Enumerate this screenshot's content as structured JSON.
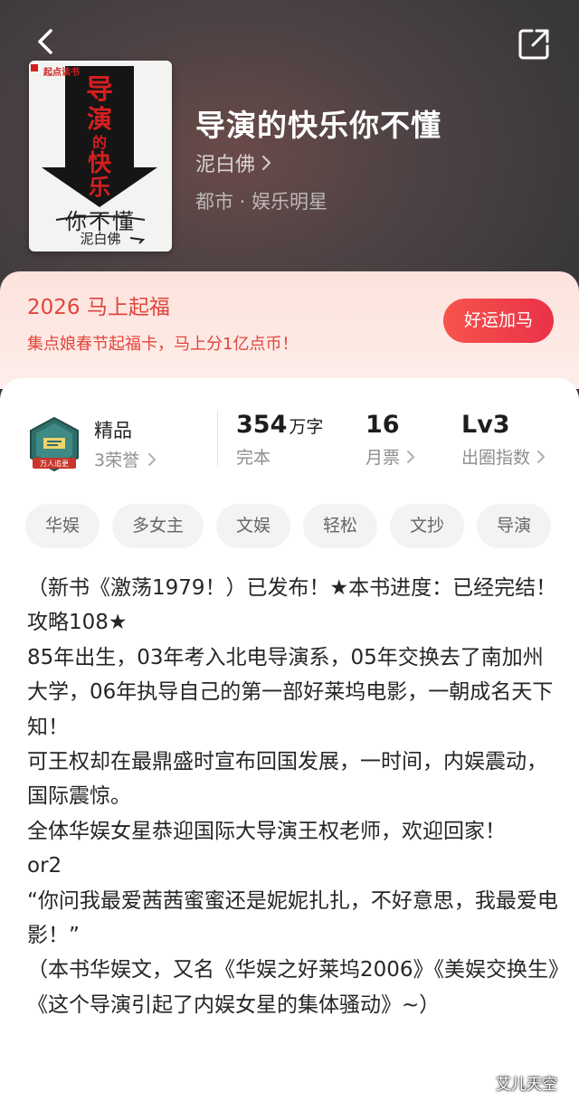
{
  "header": {
    "back_icon": "back-chevron-icon",
    "share_icon": "share-icon"
  },
  "cover": {
    "publisher": "起点读书",
    "title_art": "导演的快乐",
    "subtitle_art": "你不懂",
    "author_art": "泥白佛"
  },
  "book": {
    "title": "导演的快乐你不懂",
    "author": "泥白佛",
    "genre": "都市 · 娱乐明星"
  },
  "promo": {
    "title": "2026 马上起福",
    "description": "集点娘春节起福卡，马上分1亿点币！",
    "button": "好运加马"
  },
  "stats": {
    "badge_text": "万人追更",
    "quality": "精品",
    "honors": "3荣誉",
    "word_count": "354",
    "word_unit": "万字",
    "status": "完本",
    "monthly_tickets": "16",
    "monthly_tickets_label": "月票",
    "level": "Lv3",
    "level_label": "出圈指数"
  },
  "tags": [
    "华娱",
    "多女主",
    "文娱",
    "轻松",
    "文抄",
    "导演"
  ],
  "description": [
    "（新书《激荡1979！）已发布！★本书进度：已经完结！攻略108★",
    "85年出生，03年考入北电导演系，05年交换去了南加州大学，06年执导自己的第一部好莱坞电影，一朝成名天下知！",
    "可王权却在最鼎盛时宣布回国发展，一时间，内娱震动，国际震惊。",
    "全体华娱女星恭迎国际大导演王权老师，欢迎回家！",
    "or2",
    "“你问我最爱茜茜蜜蜜还是妮妮扎扎，不好意思，我最爱电影！”",
    "（本书华娱文，又名《华娱之好莱坞2006》《美娱交换生》《这个导演引起了内娱女星的集体骚动》~）"
  ],
  "watermark": "艾儿天空",
  "colors": {
    "accent_red": "#e2453c",
    "button_red": "#ef3f4a",
    "hero_dark": "#3a383a"
  }
}
